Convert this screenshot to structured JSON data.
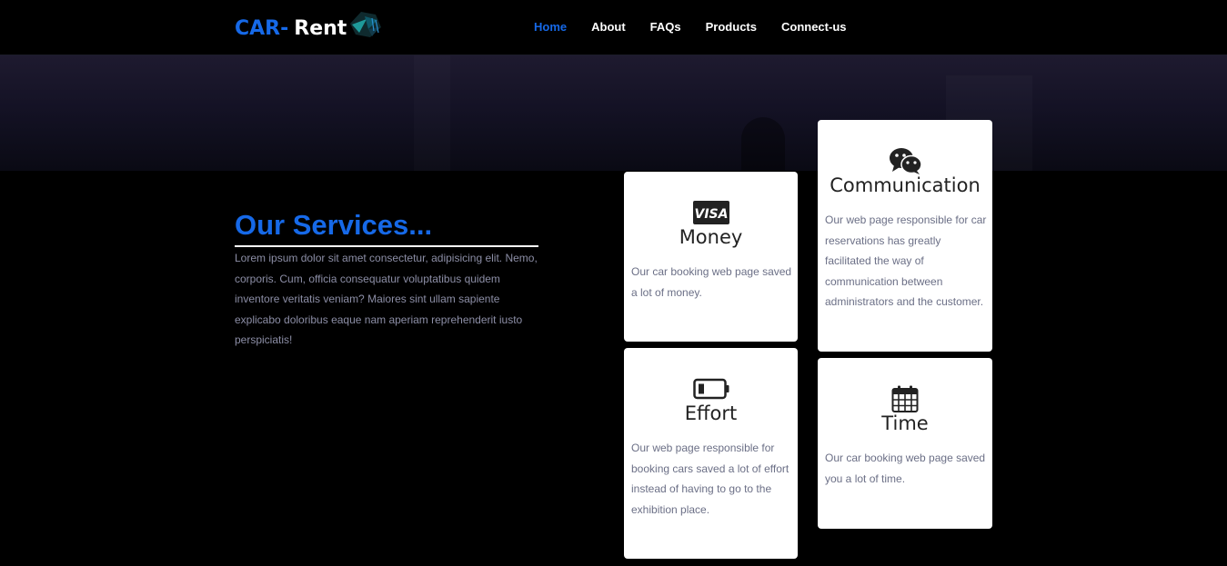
{
  "brand": {
    "part1": "CAR-",
    "part2": "Rent"
  },
  "nav": {
    "items": [
      {
        "label": "Home",
        "active": true
      },
      {
        "label": "About"
      },
      {
        "label": "FAQs"
      },
      {
        "label": "Products"
      },
      {
        "label": "Connect-us"
      }
    ]
  },
  "services": {
    "title": "Our Services...",
    "description": "Lorem ipsum dolor sit amet consectetur, adipisicing elit. Nemo, corporis. Cum, officia consequatur voluptatibus quidem inventore veritatis veniam? Maiores sint ullam sapiente explicabo doloribus eaque nam aperiam reprehenderit iusto perspiciatis!"
  },
  "cards": {
    "money": {
      "icon": "visa-card-icon",
      "badge": "VISA",
      "title": "Money",
      "text": "Our car booking web page saved a lot of money."
    },
    "communication": {
      "icon": "chat-bubbles-icon",
      "title": "Communication",
      "text": "Our web page responsible for car reservations has greatly facilitated the way of communication between administrators and the customer."
    },
    "effort": {
      "icon": "battery-low-icon",
      "title": "Effort",
      "text": "Our web page responsible for booking cars saved a lot of effort instead of having to go to the exhibition place."
    },
    "time": {
      "icon": "calendar-icon",
      "title": "Time",
      "text": "Our car booking web page saved you a lot of time."
    }
  },
  "colors": {
    "accent": "#1669e8",
    "background": "#000000",
    "card": "#ffffff",
    "muted_text": "#6b6f86"
  }
}
